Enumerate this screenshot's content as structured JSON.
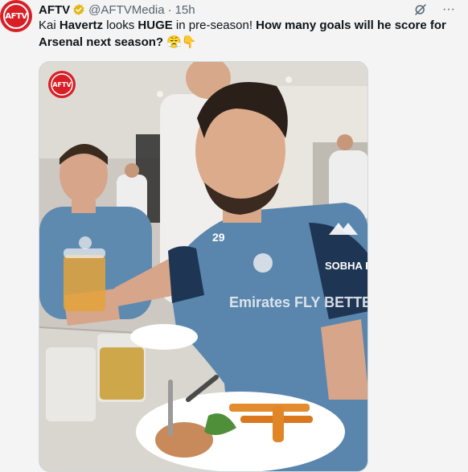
{
  "account": {
    "display_name": "AFTV",
    "handle": "@AFTVMedia",
    "separator": "·",
    "time": "15h",
    "avatar_text": "AFTV",
    "verified_icon": "verified-badge-icon"
  },
  "actions": {
    "grok_icon": "grok-icon",
    "more_icon": "more-icon",
    "more_label": "···"
  },
  "tweet": {
    "text_part1": "Kai ",
    "text_bold1": "Havertz",
    "text_part2": " looks ",
    "text_bold2": "HUGE",
    "text_part3": " in pre-season! ",
    "text_bold3": "How many goals will he score for Arsenal next season?",
    "emoji1": "😤",
    "emoji2": "👇"
  },
  "media": {
    "watermark_text": "AFTV",
    "jersey_number": "29",
    "sponsor_text": "Emirates FLY BETTER",
    "sleeve_text": "SOBHA REALTY"
  },
  "colors": {
    "brand_red": "#d81f26",
    "verified_gold": "#e2b719",
    "secondary_text": "#536471"
  }
}
